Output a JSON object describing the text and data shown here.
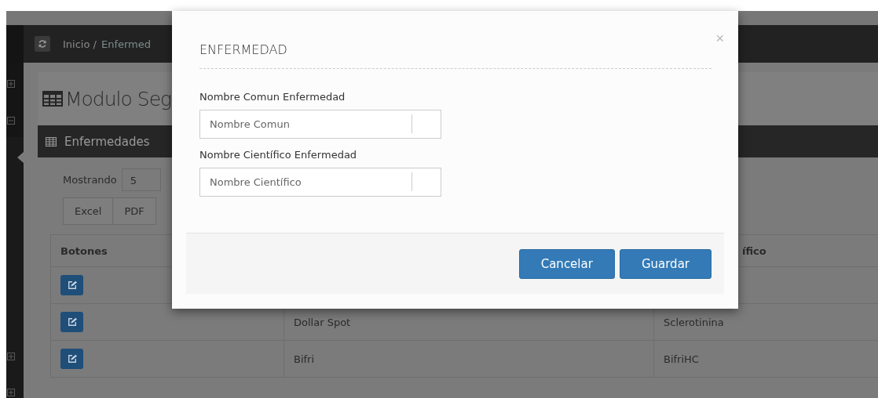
{
  "topbar": {
    "breadcrumb": [
      "Inicio /",
      "Enfermed"
    ]
  },
  "page": {
    "title": "Modulo Seg"
  },
  "panel": {
    "title": "Enfermedades",
    "page_size_label": "Mostrando",
    "page_size": "5",
    "export_buttons": [
      "Excel",
      "PDF"
    ],
    "table": {
      "column_1": "Botones",
      "column_3": "ífico",
      "rows": [
        {
          "edit_button": true
        },
        {
          "edit_button": true,
          "column_2": "Dollar Spot",
          "column_3": "Sclerotinina"
        },
        {
          "edit_button": true,
          "column_2": "Bifri",
          "column_3": "BifriHC"
        }
      ]
    }
  },
  "modal": {
    "title": "ENFERMEDAD",
    "close": "×",
    "fields": [
      {
        "label": "Nombre Comun Enfermedad",
        "placeholder": "Nombre Comun"
      },
      {
        "label": "Nombre Científico Enfermedad",
        "placeholder": "Nombre Científico"
      }
    ],
    "buttons": [
      "Cancelar",
      "Guardar"
    ]
  }
}
